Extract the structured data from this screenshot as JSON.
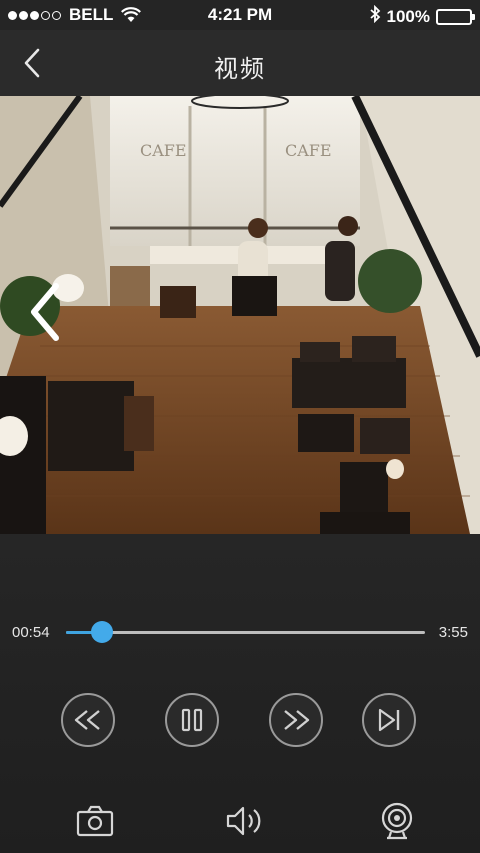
{
  "status_bar": {
    "carrier": "BELL",
    "time": "4:21 PM",
    "battery": "100%",
    "signal_bars_filled": 3,
    "signal_bars_total": 5
  },
  "nav": {
    "title": "视频",
    "back_icon": "chevron-left-icon"
  },
  "player": {
    "elapsed": "00:54",
    "total": "3:55",
    "progress": 0.1,
    "accent_color": "#3fa4e0",
    "controls": [
      "rewind-icon",
      "pause-icon",
      "fast-forward-icon",
      "next-frame-icon"
    ],
    "actions": [
      "camera-icon",
      "speaker-icon",
      "webcam-icon"
    ]
  }
}
